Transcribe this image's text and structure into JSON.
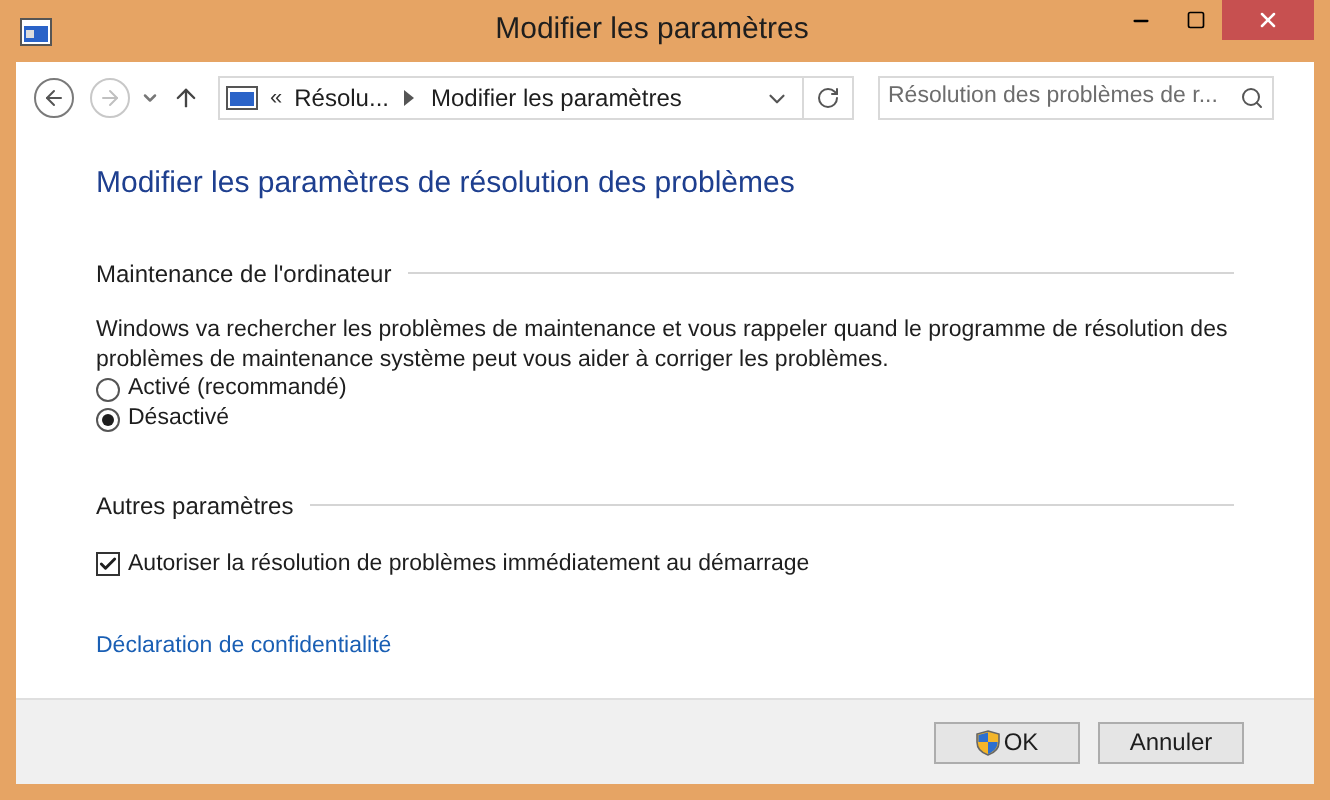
{
  "window": {
    "title": "Modifier les paramètres"
  },
  "address_bar": {
    "prefix": "«",
    "crumbs": [
      "Résolu...",
      "Modifier les paramètres"
    ]
  },
  "search": {
    "placeholder": "Résolution des problèmes de r..."
  },
  "heading": "Modifier les paramètres de résolution des problèmes",
  "maintenance": {
    "title": "Maintenance de l'ordinateur",
    "description": "Windows va rechercher les problèmes de maintenance et vous rappeler quand le programme de résolution des problèmes de maintenance système peut vous aider à corriger les problèmes.",
    "options": [
      {
        "label": "Activé (recommandé)",
        "selected": false
      },
      {
        "label": "Désactivé",
        "selected": true
      }
    ]
  },
  "other": {
    "title": "Autres paramètres",
    "checkbox": {
      "label": "Autoriser la résolution de problèmes immédiatement au démarrage",
      "checked": true
    }
  },
  "privacy_link": "Déclaration de confidentialité",
  "buttons": [
    {
      "label": "OK",
      "kind": "shield"
    },
    {
      "label": "Annuler",
      "kind": "plain"
    }
  ]
}
